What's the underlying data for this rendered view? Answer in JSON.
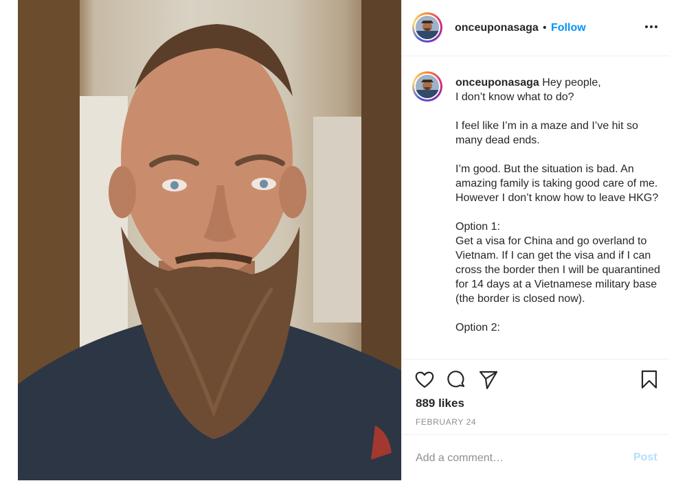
{
  "post": {
    "username": "onceuponasaga",
    "follow_separator": "•",
    "follow_label": "Follow",
    "caption_text": "Hey people,\nI don’t know what to do?\n\nI feel like I’m in a maze and I’ve hit so many dead ends.\n\nI’m good. But the situation is bad. An amazing family is taking good care of me. However I don’t know how to leave HKG?\n\nOption 1:\nGet a visa for China and go overland to Vietnam. If I can get the visa and if I can cross the border then I will be quarantined for 14 days at a Vietnamese military base (the border is closed now).\n\nOption 2:",
    "likes": "889 likes",
    "date": "FEBRUARY 24",
    "comment_placeholder": "Add a comment…",
    "post_label": "Post"
  },
  "icons": {
    "more": "more-options-icon",
    "like": "heart-icon",
    "comment": "comment-bubble-icon",
    "share": "paper-plane-icon",
    "save": "bookmark-icon"
  },
  "colors": {
    "follow": "#0095f6",
    "post_disabled": "#b2dffc",
    "muted": "#8e8e8e",
    "text": "#262626"
  }
}
